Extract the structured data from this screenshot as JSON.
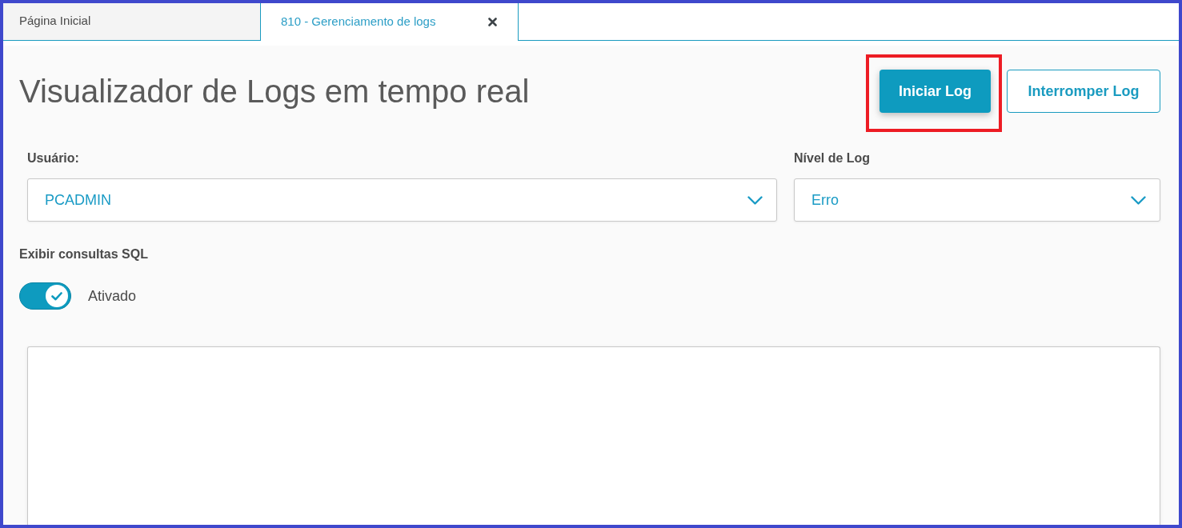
{
  "tabs": [
    {
      "label": "Página Inicial",
      "selected": false,
      "closable": false
    },
    {
      "label": "810 - Gerenciamento de logs",
      "selected": true,
      "closable": true
    }
  ],
  "header": {
    "title": "Visualizador de Logs em tempo real",
    "buttons": [
      {
        "label": "Iniciar Log",
        "kind": "primary",
        "highlighted": true
      },
      {
        "label": "Interromper Log",
        "kind": "outline",
        "highlighted": false
      }
    ]
  },
  "filters": [
    {
      "label": "Usuário:",
      "value": "PCADMIN"
    },
    {
      "label": "Nível de Log",
      "value": "Erro"
    }
  ],
  "sql_toggle": {
    "label": "Exibir consultas SQL",
    "on": true,
    "state_label": "Ativado"
  }
}
